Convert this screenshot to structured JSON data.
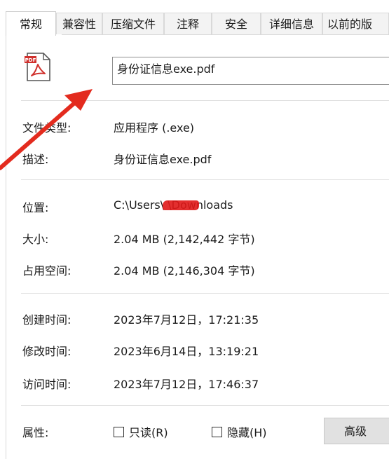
{
  "tabs": [
    {
      "label": "常规",
      "active": true
    },
    {
      "label": "兼容性"
    },
    {
      "label": "压缩文件"
    },
    {
      "label": "注释"
    },
    {
      "label": "安全"
    },
    {
      "label": "详细信息"
    },
    {
      "label": "以前的版"
    }
  ],
  "file": {
    "icon": "pdf-file-icon",
    "icon_badge": "PDF",
    "name": "身份证信息exe.pdf"
  },
  "properties": {
    "type_label": "文件类型:",
    "type_value": "应用程序 (.exe)",
    "desc_label": "描述:",
    "desc_value": "身份证信息exe.pdf",
    "location_label": "位置:",
    "location_value": "C:\\Users\\      \\Downloads",
    "size_label": "大小:",
    "size_value": "2.04 MB (2,142,442 字节)",
    "disk_label": "占用空间:",
    "disk_value": "2.04 MB (2,146,304 字节)",
    "created_label": "创建时间:",
    "created_value": "2023年7月12日，17:21:35",
    "modified_label": "修改时间:",
    "modified_value": "2023年6月14日，13:19:21",
    "accessed_label": "访问时间:",
    "accessed_value": "2023年7月12日，17:46:37"
  },
  "attributes": {
    "label": "属性:",
    "readonly_label": "只读(R)",
    "hidden_label": "隐藏(H)",
    "advanced_label": "高级"
  },
  "colors": {
    "annotation_arrow": "#e32b1e",
    "redaction": "#e01818",
    "pdf_icon": "#d0312d"
  }
}
